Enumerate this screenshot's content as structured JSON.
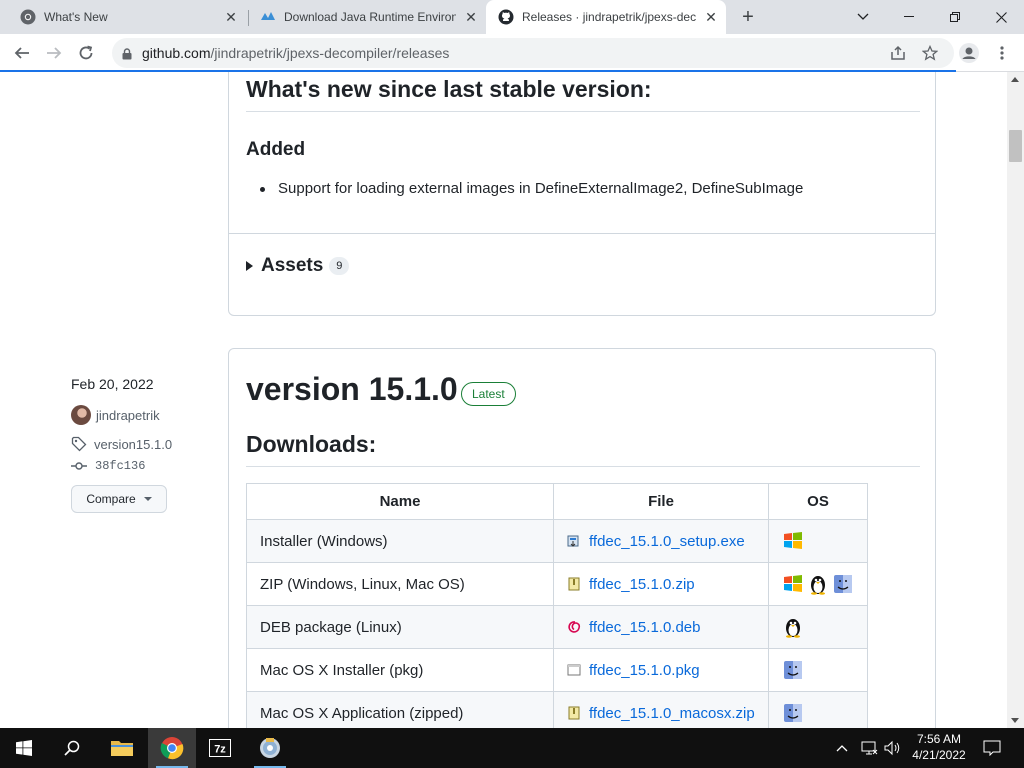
{
  "browser": {
    "tabs": [
      {
        "title": "What's New",
        "icon": "chrome-icon"
      },
      {
        "title": "Download Java Runtime Environment",
        "icon": "java-download-icon"
      },
      {
        "title": "Releases · jindrapetrik/jpexs-decompiler",
        "icon": "github-icon"
      }
    ],
    "url_host": "github.com",
    "url_path": "/jindrapetrik/jpexs-decompiler/releases"
  },
  "prev_release": {
    "heading": "What's new since last stable version:",
    "added_heading": "Added",
    "added_items": [
      "Support for loading external images in DefineExternalImage2, DefineSubImage"
    ],
    "assets_label": "Assets",
    "assets_count": "9"
  },
  "release": {
    "date": "Feb 20, 2022",
    "author": "jindrapetrik",
    "tag": "version15.1.0",
    "commit": "38fc136",
    "compare_label": "Compare",
    "title": "version 15.1.0",
    "badge": "Latest",
    "downloads_heading": "Downloads:",
    "table": {
      "headers": [
        "Name",
        "File",
        "OS"
      ],
      "rows": [
        {
          "name": "Installer (Windows)",
          "file": "ffdec_15.1.0_setup.exe",
          "os": [
            "windows"
          ]
        },
        {
          "name": "ZIP (Windows, Linux, Mac OS)",
          "file": "ffdec_15.1.0.zip",
          "os": [
            "windows",
            "linux",
            "mac"
          ]
        },
        {
          "name": "DEB package (Linux)",
          "file": "ffdec_15.1.0.deb",
          "os": [
            "linux"
          ]
        },
        {
          "name": "Mac OS X Installer (pkg)",
          "file": "ffdec_15.1.0.pkg",
          "os": [
            "mac"
          ]
        },
        {
          "name": "Mac OS X Application (zipped)",
          "file": "ffdec_15.1.0_macosx.zip",
          "os": [
            "mac"
          ]
        }
      ]
    }
  },
  "taskbar": {
    "time": "7:56 AM",
    "date": "4/21/2022"
  },
  "colors": {
    "link": "#0969da",
    "latest_badge": "#1a7f37",
    "border": "#d0d7de",
    "tabstrip": "#dee1e6"
  }
}
